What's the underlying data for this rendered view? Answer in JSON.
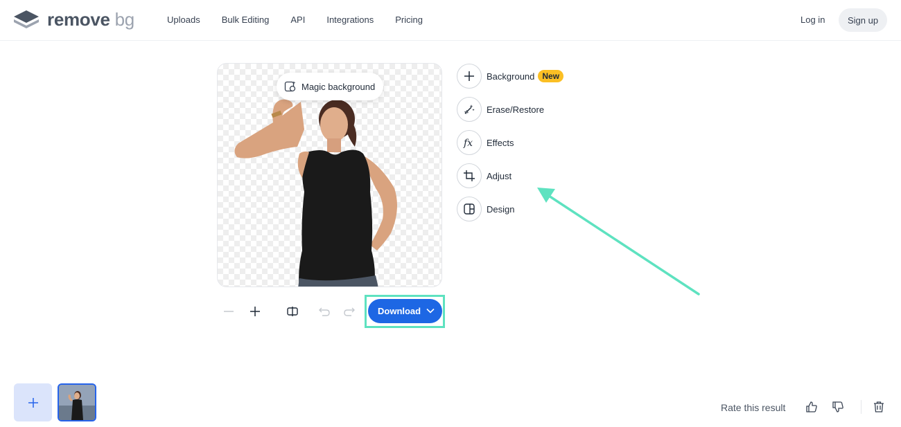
{
  "header": {
    "logo": {
      "word1": "remove",
      "word2": "bg",
      "icon": "stacked-layers-logo-icon"
    },
    "nav": [
      "Uploads",
      "Bulk Editing",
      "API",
      "Integrations",
      "Pricing"
    ],
    "login": "Log in",
    "signup": "Sign up"
  },
  "editor": {
    "magic_background": "Magic background",
    "tools": [
      {
        "label": "Background",
        "icon": "plus-icon",
        "badge": "New"
      },
      {
        "label": "Erase/Restore",
        "icon": "magic-wand-icon"
      },
      {
        "label": "Effects",
        "icon": "fx-icon"
      },
      {
        "label": "Adjust",
        "icon": "crop-icon"
      },
      {
        "label": "Design",
        "icon": "layout-icon"
      }
    ],
    "download": "Download"
  },
  "footer": {
    "rate": "Rate this result"
  },
  "colors": {
    "accent": "#1d67e4",
    "highlight": "#5ee2c0",
    "badge": "#fbbf24"
  }
}
